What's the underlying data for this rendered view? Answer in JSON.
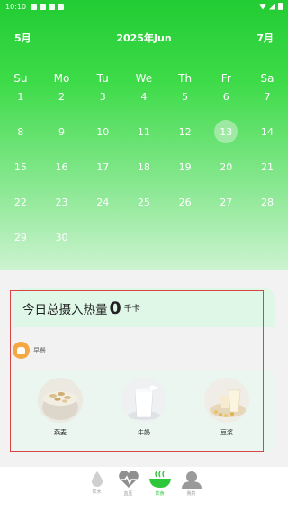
{
  "status_bar": {
    "time": "10:10"
  },
  "calendar": {
    "prev_month": "5月",
    "title": "2025年Jun",
    "next_month": "7月",
    "weekdays": [
      "Su",
      "Mo",
      "Tu",
      "We",
      "Th",
      "Fr",
      "Sa"
    ],
    "weeks": [
      [
        "1",
        "2",
        "3",
        "4",
        "5",
        "6",
        "7"
      ],
      [
        "8",
        "9",
        "10",
        "11",
        "12",
        "13",
        "14"
      ],
      [
        "15",
        "16",
        "17",
        "18",
        "19",
        "20",
        "21"
      ],
      [
        "22",
        "23",
        "24",
        "25",
        "26",
        "27",
        "28"
      ],
      [
        "29",
        "30",
        "",
        "",
        "",
        "",
        ""
      ]
    ],
    "selected_day": "13"
  },
  "summary": {
    "label": "今日总摄入热量",
    "value": "0",
    "unit": "千卡"
  },
  "meal": {
    "title": "早餐",
    "foods": [
      {
        "name": "燕麦"
      },
      {
        "name": "牛奶"
      },
      {
        "name": "豆浆"
      }
    ]
  },
  "tabs": [
    {
      "label": "饮水",
      "icon": "water-drop-icon",
      "active": false
    },
    {
      "label": "血压",
      "icon": "heart-pulse-icon",
      "active": false
    },
    {
      "label": "饮食",
      "icon": "food-bowl-icon",
      "active": true
    },
    {
      "label": "我的",
      "icon": "person-icon",
      "active": false
    }
  ],
  "colors": {
    "accent": "#2ec73a",
    "summary_bg": "#def7e7",
    "highlight_border": "#d94545",
    "meal_icon": "#f5a742"
  }
}
